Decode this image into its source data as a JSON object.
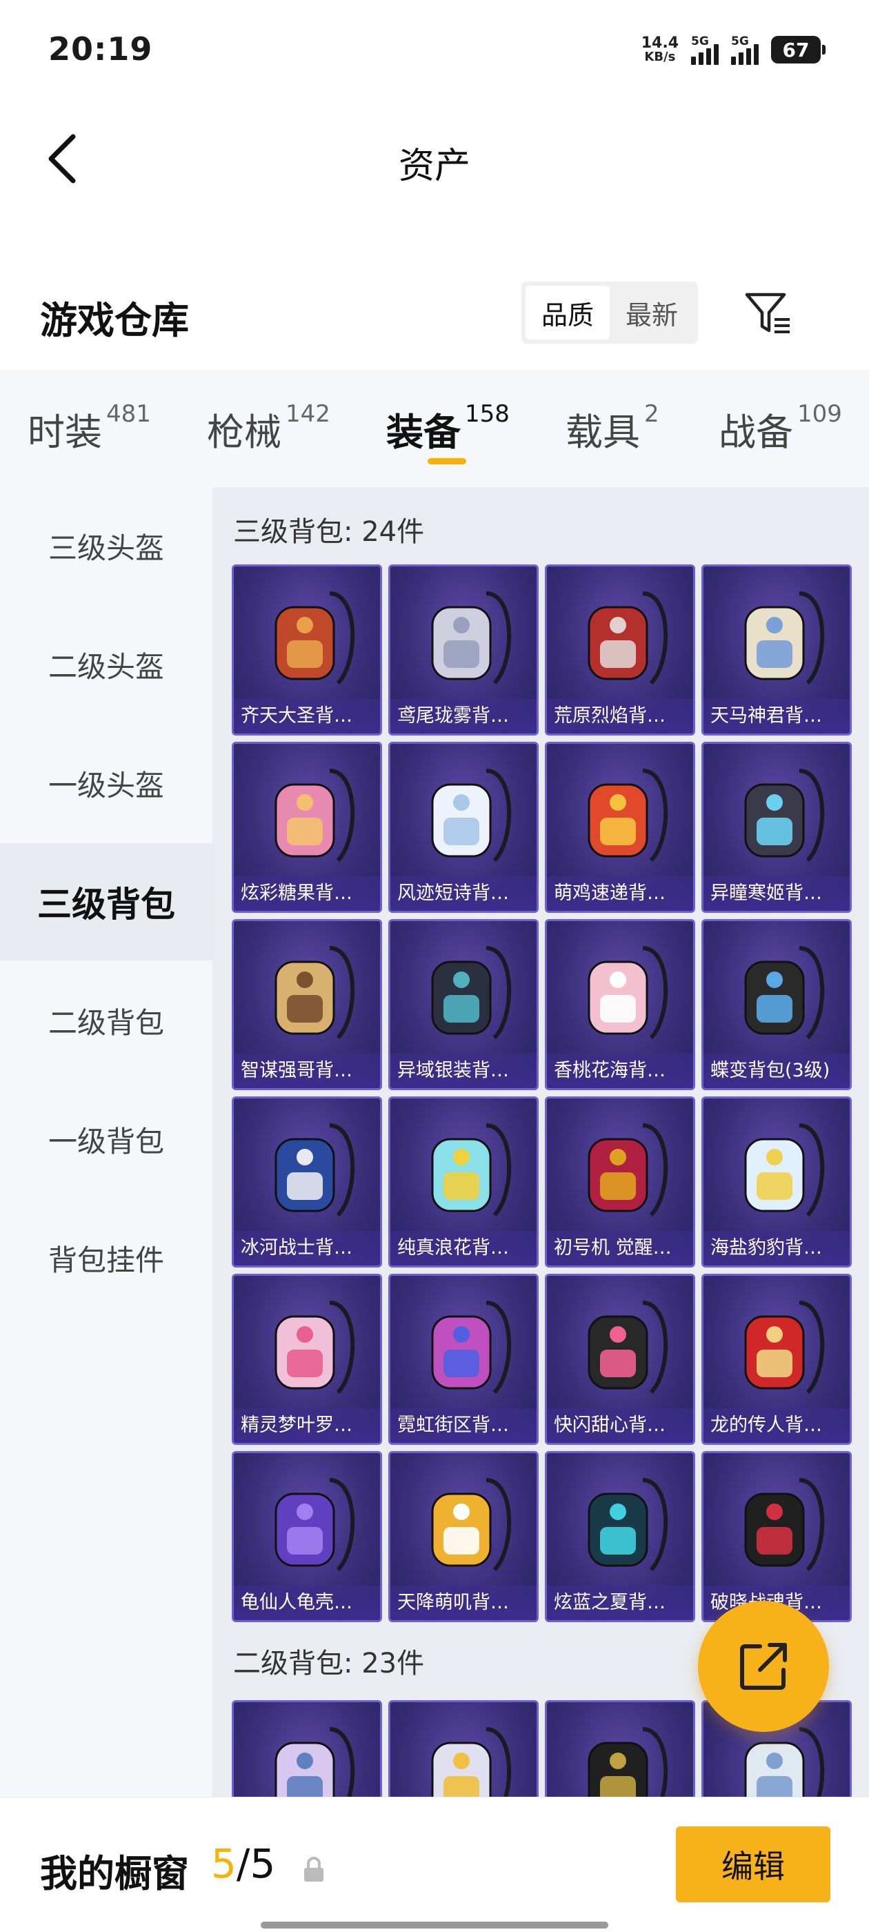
{
  "status": {
    "time": "20:19",
    "net_speed_value": "14.4",
    "net_speed_unit": "KB/s",
    "signal1_label": "5G",
    "signal2_label": "5G",
    "battery": "67"
  },
  "header": {
    "title": "资产",
    "back_icon": "chevron-left-icon"
  },
  "warehouse": {
    "title": "游戏仓库",
    "sort_options": [
      "品质",
      "最新"
    ],
    "sort_selected": "品质",
    "filter_icon": "filter-icon"
  },
  "tabs": [
    {
      "label": "时装",
      "count": "481"
    },
    {
      "label": "枪械",
      "count": "142"
    },
    {
      "label": "装备",
      "count": "158",
      "active": true
    },
    {
      "label": "载具",
      "count": "2"
    },
    {
      "label": "战备",
      "count": "109"
    }
  ],
  "sidebar": {
    "items": [
      {
        "label": "三级头盔"
      },
      {
        "label": "二级头盔"
      },
      {
        "label": "一级头盔"
      },
      {
        "label": "三级背包",
        "active": true
      },
      {
        "label": "二级背包"
      },
      {
        "label": "一级背包"
      },
      {
        "label": "背包挂件"
      }
    ]
  },
  "sections": [
    {
      "title": "三级背包: 24件",
      "items": [
        {
          "name": "齐天大圣背…",
          "icon": "monkey-king-mask-backpack-icon"
        },
        {
          "name": "鸢尾珑雾背…",
          "icon": "iris-mist-bag-icon"
        },
        {
          "name": "荒原烈焰背…",
          "icon": "wasteland-flame-backpack-icon"
        },
        {
          "name": "天马神君背…",
          "icon": "pegasus-scroll-backpack-icon"
        },
        {
          "name": "炫彩糖果背…",
          "icon": "donut-backpack-icon"
        },
        {
          "name": "风迹短诗背…",
          "icon": "bow-bag-icon"
        },
        {
          "name": "萌鸡速递背…",
          "icon": "chick-backpack-icon"
        },
        {
          "name": "异瞳寒姬背…",
          "icon": "bunny-robot-backpack-icon"
        },
        {
          "name": "智谋强哥背…",
          "icon": "mushroom-figure-backpack-icon"
        },
        {
          "name": "异域银装背…",
          "icon": "tactical-backpack-icon"
        },
        {
          "name": "香桃花海背…",
          "icon": "flower-dress-backpack-icon"
        },
        {
          "name": "蝶变背包(3级)",
          "icon": "butterfly-backpack-icon"
        },
        {
          "name": "冰河战士背…",
          "icon": "glacier-warrior-backpack-icon"
        },
        {
          "name": "纯真浪花背…",
          "icon": "drink-cup-backpack-icon"
        },
        {
          "name": "初号机 觉醒…",
          "icon": "mecha-shield-backpack-icon"
        },
        {
          "name": "海盐豹豹背…",
          "icon": "sea-lion-backpack-icon"
        },
        {
          "name": "精灵梦叶罗…",
          "icon": "heart-fairy-backpack-icon"
        },
        {
          "name": "霓虹街区背…",
          "icon": "neon-backpack-icon"
        },
        {
          "name": "快闪甜心背…",
          "icon": "peace-backpack-icon"
        },
        {
          "name": "龙的传人背…",
          "icon": "dragon-heir-backpack-icon"
        },
        {
          "name": "龟仙人龟壳…",
          "icon": "turtle-shell-backpack-icon"
        },
        {
          "name": "天降萌叽背…",
          "icon": "yellow-backpack-icon"
        },
        {
          "name": "炫蓝之夏背…",
          "icon": "blue-summer-backpack-icon"
        },
        {
          "name": "破晓战魂背…",
          "icon": "dawn-spirit-backpack-icon"
        }
      ]
    },
    {
      "title": "二级背包: 23件",
      "items": [
        {
          "name": "",
          "icon": "scroll-backpack-icon"
        },
        {
          "name": "",
          "icon": "cup-backpack-icon"
        },
        {
          "name": "",
          "icon": "dark-helmet-backpack-icon"
        },
        {
          "name": "",
          "icon": "pouch-backpack-icon"
        }
      ]
    }
  ],
  "share_icon": "share-icon",
  "bottom": {
    "showcase_label": "我的橱窗",
    "showcase_current": "5",
    "showcase_sep": "/",
    "showcase_total": "5",
    "lock_icon": "lock-icon",
    "edit_label": "编辑"
  },
  "colors": {
    "accent": "#F7B21A",
    "card_bg": "#3A2E78",
    "card_border": "#6F5FD0"
  }
}
